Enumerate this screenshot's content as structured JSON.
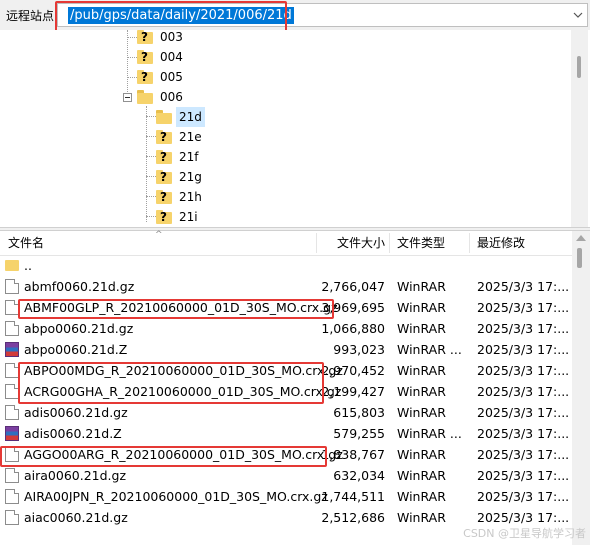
{
  "remote_site": {
    "label": "远程站点:",
    "path": "/pub/gps/data/daily/2021/006/21d"
  },
  "tree": {
    "items": [
      {
        "label": "003",
        "icon": "question-folder-icon",
        "selected": false
      },
      {
        "label": "004",
        "icon": "question-folder-icon",
        "selected": false
      },
      {
        "label": "005",
        "icon": "question-folder-icon",
        "selected": false
      },
      {
        "label": "006",
        "icon": "folder-open-icon",
        "selected": false,
        "expanded": true
      },
      {
        "label": "21d",
        "icon": "folder-icon",
        "selected": true
      },
      {
        "label": "21e",
        "icon": "question-folder-icon",
        "selected": false
      },
      {
        "label": "21f",
        "icon": "question-folder-icon",
        "selected": false
      },
      {
        "label": "21g",
        "icon": "question-folder-icon",
        "selected": false
      },
      {
        "label": "21h",
        "icon": "question-folder-icon",
        "selected": false
      },
      {
        "label": "21i",
        "icon": "question-folder-icon",
        "selected": false
      }
    ]
  },
  "columns": {
    "name": "文件名",
    "size": "文件大小",
    "type": "文件类型",
    "modified": "最近修改"
  },
  "files": [
    {
      "name": "..",
      "size": "",
      "type": "",
      "modified": "",
      "icon": "parent-folder-icon"
    },
    {
      "name": "abmf0060.21d.gz",
      "size": "2,766,047",
      "type": "WinRAR",
      "modified": "2025/3/3 17:...",
      "icon": "file-icon"
    },
    {
      "name": "ABMF00GLP_R_20210060000_01D_30S_MO.crx.gz",
      "size": "3,969,695",
      "type": "WinRAR",
      "modified": "2025/3/3 17:...",
      "icon": "file-icon"
    },
    {
      "name": "abpo0060.21d.gz",
      "size": "1,066,880",
      "type": "WinRAR",
      "modified": "2025/3/3 17:...",
      "icon": "file-icon"
    },
    {
      "name": "abpo0060.21d.Z",
      "size": "993,023",
      "type": "WinRAR ...",
      "modified": "2025/3/3 17:...",
      "icon": "winrar-icon"
    },
    {
      "name": "ABPO00MDG_R_20210060000_01D_30S_MO.crx.gz",
      "size": "2,970,452",
      "type": "WinRAR",
      "modified": "2025/3/3 17:...",
      "icon": "file-icon"
    },
    {
      "name": "ACRG00GHA_R_20210060000_01D_30S_MO.crx.gz",
      "size": "2,199,427",
      "type": "WinRAR",
      "modified": "2025/3/3 17:...",
      "icon": "file-icon"
    },
    {
      "name": "adis0060.21d.gz",
      "size": "615,803",
      "type": "WinRAR",
      "modified": "2025/3/3 17:...",
      "icon": "file-icon"
    },
    {
      "name": "adis0060.21d.Z",
      "size": "579,255",
      "type": "WinRAR ...",
      "modified": "2025/3/3 17:...",
      "icon": "winrar-icon"
    },
    {
      "name": "AGGO00ARG_R_20210060000_01D_30S_MO.crx.gz",
      "size": "1,838,767",
      "type": "WinRAR",
      "modified": "2025/3/3 17:...",
      "icon": "file-icon"
    },
    {
      "name": "aira0060.21d.gz",
      "size": "632,034",
      "type": "WinRAR",
      "modified": "2025/3/3 17:...",
      "icon": "file-icon"
    },
    {
      "name": "AIRA00JPN_R_20210060000_01D_30S_MO.crx.gz",
      "size": "1,744,511",
      "type": "WinRAR",
      "modified": "2025/3/3 17:...",
      "icon": "file-icon"
    },
    {
      "name": "aiac0060.21d.gz",
      "size": "2,512,686",
      "type": "WinRAR",
      "modified": "2025/3/3 17:...",
      "icon": "file-icon"
    }
  ],
  "watermark": "CSDN @卫星导航学习者"
}
